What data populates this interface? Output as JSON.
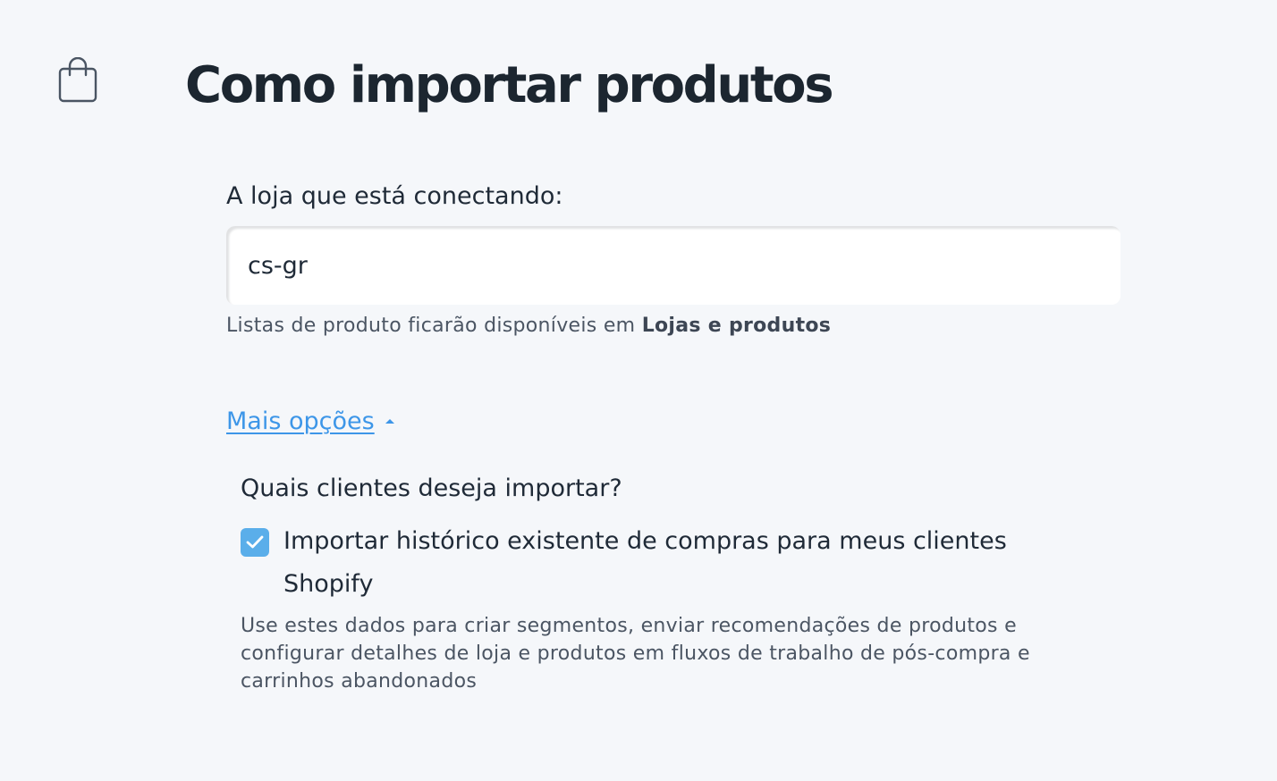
{
  "header": {
    "icon": "shopping-bag-icon",
    "title": "Como importar produtos"
  },
  "store": {
    "label": "A loja que está conectando:",
    "value": "cs-gr",
    "helper_prefix": "Listas de produto ficarão disponíveis em ",
    "helper_strong": "Lojas e produtos"
  },
  "more_options": {
    "label": "Mais opções",
    "expanded": true
  },
  "customers": {
    "question": "Quais clientes deseja importar?",
    "checkbox_label": "Importar histórico existente de compras para meus clientes Shopify",
    "checked": true,
    "description": "Use estes dados para criar segmentos, enviar recomendações de produtos e configurar detalhes de loja e produtos em fluxos de trabalho de pós-compra e carrinhos abandonados"
  },
  "colors": {
    "background": "#f5f7fa",
    "link": "#3d96e8",
    "checkbox": "#5aaeea",
    "text": "#1f2a37",
    "muted_text": "#4b5563"
  }
}
